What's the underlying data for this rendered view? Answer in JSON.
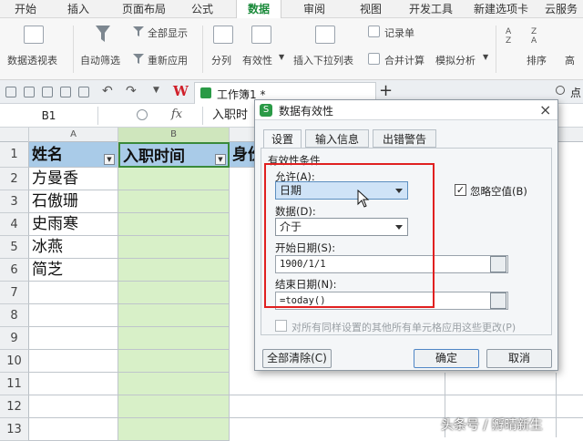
{
  "menu": {
    "items": [
      "开始",
      "插入",
      "页面布局",
      "公式",
      "数据",
      "审阅",
      "视图",
      "开发工具",
      "新建选项卡",
      "云服务"
    ],
    "active": "数据"
  },
  "ribbon": {
    "pivot": "数据透视表",
    "autofilter": "自动筛选",
    "show_all": "全部显示",
    "reapply": "重新应用",
    "split": "分列",
    "validation": "有效性",
    "insert_dropdown": "插入下拉列表",
    "record": "记录单",
    "consolidate": "合并计算",
    "simulate": "模拟分析",
    "sort": "排序",
    "advanced": "高"
  },
  "tabs": {
    "doc_tab": "工作簿1 *",
    "add": "+",
    "search_hint": "点"
  },
  "formula_bar": {
    "cell_ref": "B1",
    "fx": "fx",
    "content": "入职时"
  },
  "grid": {
    "columns": [
      "A",
      "B"
    ],
    "rows": [
      "1",
      "2",
      "3",
      "4",
      "5",
      "6",
      "7",
      "8",
      "9",
      "10",
      "11",
      "12",
      "13"
    ],
    "header": {
      "a1": "姓名",
      "b1": "入职时间",
      "c1": "身份"
    },
    "names": [
      "方曼香",
      "石傲珊",
      "史雨寒",
      "冰燕",
      "简芝"
    ],
    "selected_column_fill": "#d8f0c8",
    "header_fill": "#a9cbe8"
  },
  "dialog": {
    "title": "数据有效性",
    "tabs": [
      "设置",
      "输入信息",
      "出错警告"
    ],
    "section": "有效性条件",
    "allow_label": "允许(A):",
    "allow_value": "日期",
    "ignore_blank": "忽略空值(B)",
    "data_label": "数据(D):",
    "data_value": "介于",
    "start_label": "开始日期(S):",
    "start_value": "1900/1/1",
    "end_label": "结束日期(N):",
    "end_value": "=today()",
    "apply_all": "对所有同样设置的其他所有单元格应用这些更改(P)",
    "clear_all": "全部清除(C)",
    "ok": "确定",
    "cancel": "取消",
    "close": "×"
  },
  "watermark": "头条号 / 孵晴新生",
  "accent_colors": {
    "highlight_box": "#e02020",
    "brand": "#1a8a3a"
  }
}
